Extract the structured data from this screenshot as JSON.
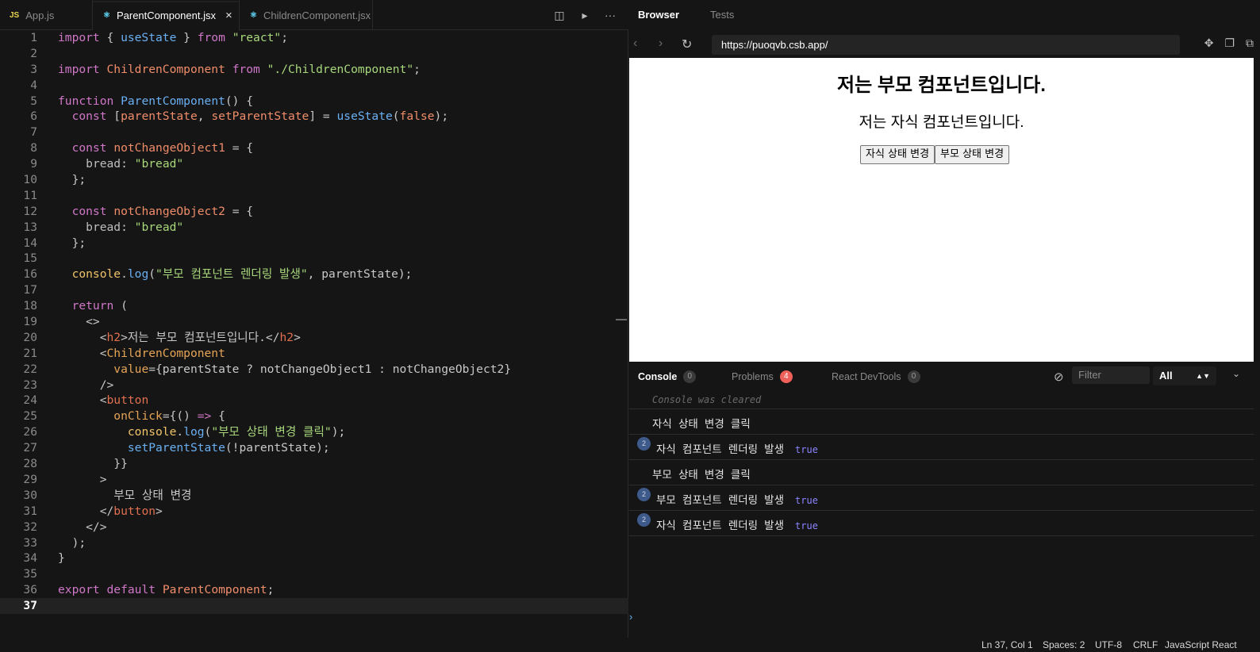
{
  "editor": {
    "tabs": [
      {
        "icon": "JS",
        "label": "App.js"
      },
      {
        "icon": "⚛",
        "label": "ParentComponent.jsx",
        "close": "×"
      },
      {
        "icon": "⚛",
        "label": "ChildrenComponent.jsx"
      }
    ],
    "actions": {
      "split": "◫",
      "preview": "▸",
      "more": "···"
    },
    "line_numbers": [
      "1",
      "2",
      "3",
      "4",
      "5",
      "6",
      "7",
      "8",
      "9",
      "10",
      "11",
      "12",
      "13",
      "14",
      "15",
      "16",
      "17",
      "18",
      "19",
      "20",
      "21",
      "22",
      "23",
      "24",
      "25",
      "26",
      "27",
      "28",
      "29",
      "30",
      "31",
      "32",
      "33",
      "34",
      "35",
      "36",
      "37"
    ],
    "code": {
      "l1": [
        "import",
        " { ",
        "useState",
        " } ",
        "from",
        " ",
        "\"react\"",
        ";"
      ],
      "l3": [
        "import",
        " ",
        "ChildrenComponent",
        " ",
        "from",
        " ",
        "\"./ChildrenComponent\"",
        ";"
      ],
      "l5": [
        "function",
        " ",
        "ParentComponent",
        "() {"
      ],
      "l6": [
        "  ",
        "const",
        " [",
        "parentState",
        ", ",
        "setParentState",
        "] = ",
        "useState",
        "(",
        "false",
        ");"
      ],
      "l8": [
        "  ",
        "const",
        " ",
        "notChangeObject1",
        " = {"
      ],
      "l9": [
        "    ",
        "bread",
        ": ",
        "\"bread\""
      ],
      "l10": "  };",
      "l12": [
        "  ",
        "const",
        " ",
        "notChangeObject2",
        " = {"
      ],
      "l13": [
        "    ",
        "bread",
        ": ",
        "\"bread\""
      ],
      "l14": "  };",
      "l16": [
        "  ",
        "console",
        ".",
        "log",
        "(",
        "\"부모 컴포넌트 렌더링 발생\"",
        ", parentState);"
      ],
      "l18": [
        "  ",
        "return",
        " ("
      ],
      "l19": "    <>",
      "l20": [
        "      <",
        "h2",
        ">저는 부모 컴포넌트입니다.</",
        "h2",
        ">"
      ],
      "l21": [
        "      <",
        "ChildrenComponent"
      ],
      "l22": [
        "        ",
        "value",
        "={parentState ? notChangeObject1 : notChangeObject2}"
      ],
      "l23": "      />",
      "l24": [
        "      <",
        "button"
      ],
      "l25": [
        "        ",
        "onClick",
        "={() ",
        "=>",
        " {"
      ],
      "l26": [
        "          ",
        "console",
        ".",
        "log",
        "(",
        "\"부모 상태 변경 클릭\"",
        ");"
      ],
      "l27": [
        "          ",
        "setParentState",
        "(!parentState);"
      ],
      "l28": "        }}",
      "l29": "      >",
      "l30": "        부모 상태 변경",
      "l31": [
        "      </",
        "button",
        ">"
      ],
      "l32": "    </>",
      "l33": "  );",
      "l34": "}",
      "l36": [
        "export",
        " ",
        "default",
        " ",
        "ParentComponent",
        ";"
      ]
    }
  },
  "preview": {
    "tabs": {
      "browser": "Browser",
      "tests": "Tests"
    },
    "nav": {
      "back": "‹",
      "forward": "›",
      "refresh": "↻"
    },
    "url": "https://puoqvb.csb.app/",
    "url_icons": {
      "inspect": "✥",
      "copy": "❐",
      "open": "⧉"
    },
    "page": {
      "heading": "저는 부모 컴포넌트입니다.",
      "child_heading": "저는 자식 컴포넌트입니다.",
      "child_button": "자식 상태 변경",
      "parent_button": "부모 상태 변경"
    },
    "console_tabs": [
      {
        "label": "Console",
        "count": "0"
      },
      {
        "label": "Problems",
        "count": "4"
      },
      {
        "label": "React DevTools",
        "count": "0"
      }
    ],
    "filter_placeholder": "Filter",
    "level": "All",
    "messages": [
      {
        "text": "Console was cleared"
      },
      {
        "text": "자식 상태 변경 클릭"
      },
      {
        "count": "2",
        "text": "자식 컴포넌트 렌더링 발생",
        "value": "true"
      },
      {
        "text": "부모 상태 변경 클릭"
      },
      {
        "count": "2",
        "text": "부모 컴포넌트 렌더링 발생",
        "value": "true"
      },
      {
        "count": "2",
        "text": "자식 컴포넌트 렌더링 발생",
        "value": "true"
      }
    ],
    "prompt": "›"
  },
  "status": {
    "position": "Ln 37, Col 1",
    "spaces": "Spaces: 2",
    "encoding": "UTF-8",
    "eol": "CRLF",
    "language": "JavaScript React"
  },
  "colors": {
    "background": "#151515",
    "keyword": "#d077c8",
    "function": "#6ab0f3",
    "string": "#a8d77c",
    "variable": "#f08d6a",
    "problems_badge": "#f0605a"
  }
}
